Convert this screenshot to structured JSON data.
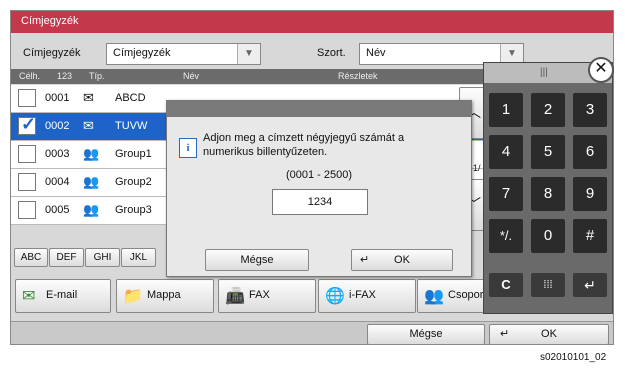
{
  "window": {
    "title": "Címjegyzék"
  },
  "filter": {
    "label": "Címjegyzék",
    "value": "Címjegyzék",
    "sort_label": "Szort.",
    "sort_value": "Név"
  },
  "table": {
    "headers": {
      "dest": "Célh.",
      "num": "123",
      "type": "Típ.",
      "name": "Név",
      "details": "Részletek"
    },
    "rows": [
      {
        "num": "0001",
        "icon": "envelope-icon",
        "name": "ABCD",
        "checked": false
      },
      {
        "num": "0002",
        "icon": "envelope-icon",
        "name": "TUVW",
        "checked": true
      },
      {
        "num": "0003",
        "icon": "group-icon",
        "name": "Group1",
        "checked": false
      },
      {
        "num": "0004",
        "icon": "group-icon",
        "name": "Group2",
        "checked": false
      },
      {
        "num": "0005",
        "icon": "group-icon",
        "name": "Group3",
        "checked": false
      }
    ],
    "page_indicator": "1/"
  },
  "alpha_tabs": [
    "ABC",
    "DEF",
    "GHI",
    "JKL"
  ],
  "destinations": [
    {
      "label": "E-mail",
      "icon": "envelope-icon"
    },
    {
      "label": "Mappa",
      "icon": "folder-icon"
    },
    {
      "label": "FAX",
      "icon": "fax-icon"
    },
    {
      "label": "i-FAX",
      "icon": "ifax-icon"
    },
    {
      "label": "Csoport",
      "icon": "group-icon"
    }
  ],
  "dialog": {
    "message": "Adjon meg a címzett négyjegyű számát a numerikus billentyűzeten.",
    "range": "(0001 - 2500)",
    "input_value": "1234",
    "cancel": "Mégse",
    "ok": "OK"
  },
  "footer": {
    "cancel": "Mégse",
    "ok": "OK"
  },
  "keypad": {
    "keys": [
      "1",
      "2",
      "3",
      "4",
      "5",
      "6",
      "7",
      "8",
      "9",
      "*/.",
      "0",
      "#"
    ],
    "clear": "C",
    "enter": "↵",
    "grid": "⁞⁞⁞"
  },
  "image_id": "s02010101_02",
  "colors": {
    "title": "#c4384b",
    "selected": "#1e64c8",
    "keypad_key": "#2b2b2b"
  }
}
